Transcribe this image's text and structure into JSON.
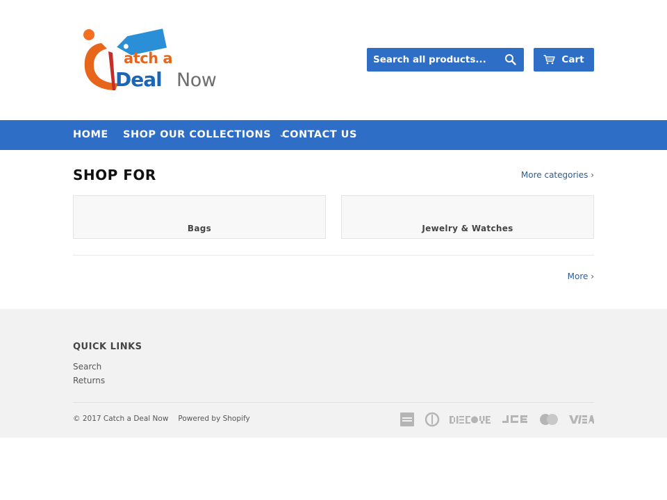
{
  "header": {
    "logo": {
      "part1": "atch a",
      "part2": "Deal",
      "part3": "Now",
      "alt": "Catch a Deal Now"
    },
    "search": {
      "placeholder": "Search all products...",
      "icon": "search-icon"
    },
    "cart": {
      "label": "Cart",
      "icon": "cart-icon"
    }
  },
  "nav": {
    "items": [
      {
        "label": "HOME"
      },
      {
        "label": "SHOP OUR COLLECTIONS",
        "chevron": "⌄"
      },
      {
        "label": "CONTACT US"
      }
    ]
  },
  "main": {
    "title": "SHOP FOR",
    "more_categories": "More categories ›",
    "collections": [
      {
        "label": "Bags"
      },
      {
        "label": "Jewelry & Watches"
      }
    ],
    "more": "More ›"
  },
  "footer": {
    "quick_links_title": "QUICK LINKS",
    "links": [
      {
        "label": "Search"
      },
      {
        "label": "Returns"
      }
    ],
    "copyright": "© 2017 Catch a Deal Now",
    "powered_by": "Powered by Shopify",
    "payment_icons": [
      "american-express-icon",
      "diners-club-icon",
      "discover-icon",
      "jcb-icon",
      "master-icon",
      "visa-icon"
    ]
  },
  "colors": {
    "brand_blue": "#2e6ec6",
    "brand_orange": "#e8651c",
    "footer_bg": "#f2f2f2"
  }
}
